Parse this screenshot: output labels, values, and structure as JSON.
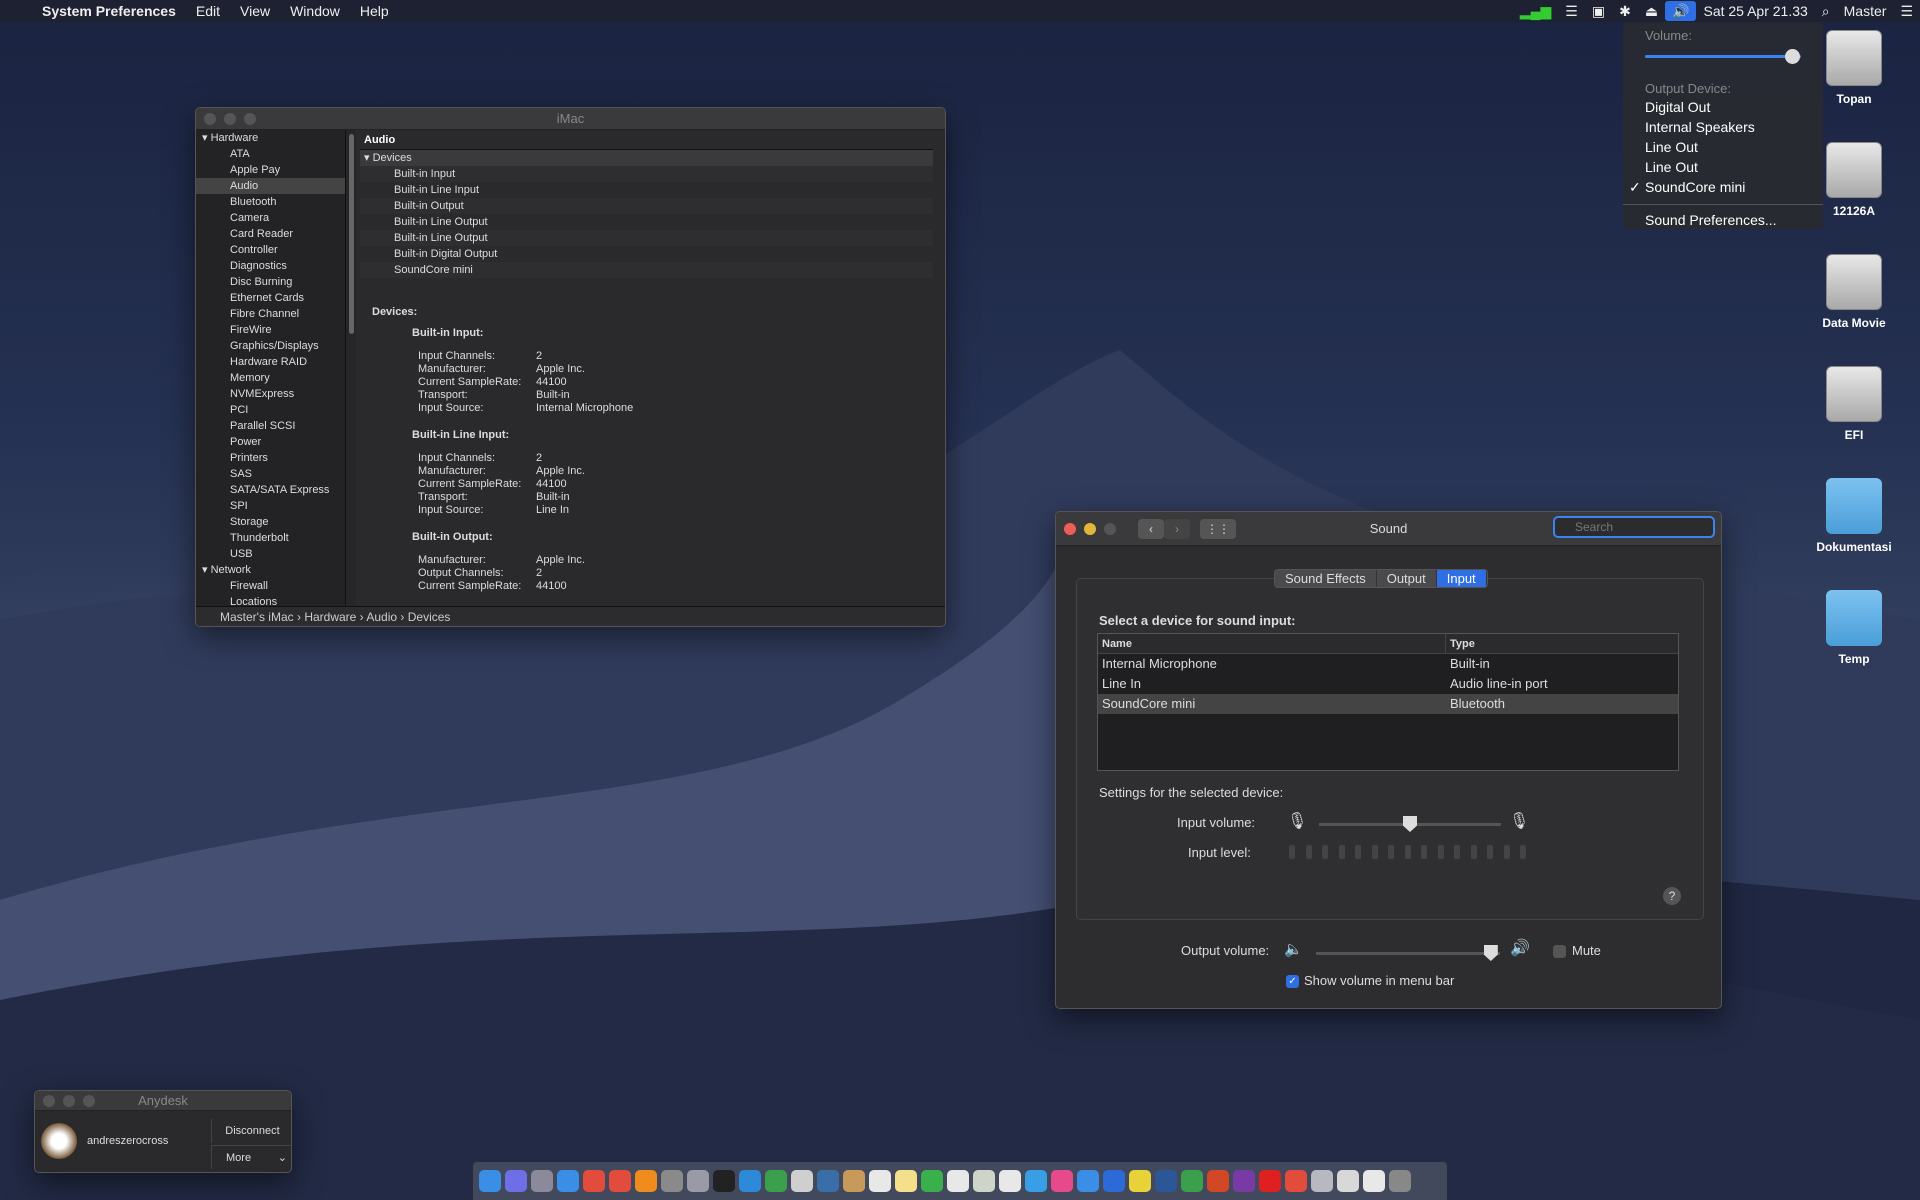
{
  "menubar": {
    "apple": "",
    "app": "System Preferences",
    "items": [
      "Edit",
      "View",
      "Window",
      "Help"
    ],
    "clock": "Sat 25 Apr  21.33",
    "user": "Master"
  },
  "volume_menu": {
    "volume_label": "Volume:",
    "volume_level": 0.95,
    "output_label": "Output Device:",
    "devices": [
      "Digital Out",
      "Internal Speakers",
      "Line Out",
      "Line Out",
      "SoundCore mini"
    ],
    "selected_index": 4,
    "prefs": "Sound Preferences..."
  },
  "imac_window": {
    "title": "iMac",
    "sidebar": [
      {
        "label": "Hardware",
        "group": true
      },
      {
        "label": "ATA"
      },
      {
        "label": "Apple Pay"
      },
      {
        "label": "Audio",
        "selected": true
      },
      {
        "label": "Bluetooth"
      },
      {
        "label": "Camera"
      },
      {
        "label": "Card Reader"
      },
      {
        "label": "Controller"
      },
      {
        "label": "Diagnostics"
      },
      {
        "label": "Disc Burning"
      },
      {
        "label": "Ethernet Cards"
      },
      {
        "label": "Fibre Channel"
      },
      {
        "label": "FireWire"
      },
      {
        "label": "Graphics/Displays"
      },
      {
        "label": "Hardware RAID"
      },
      {
        "label": "Memory"
      },
      {
        "label": "NVMExpress"
      },
      {
        "label": "PCI"
      },
      {
        "label": "Parallel SCSI"
      },
      {
        "label": "Power"
      },
      {
        "label": "Printers"
      },
      {
        "label": "SAS"
      },
      {
        "label": "SATA/SATA Express"
      },
      {
        "label": "SPI"
      },
      {
        "label": "Storage"
      },
      {
        "label": "Thunderbolt"
      },
      {
        "label": "USB"
      },
      {
        "label": "Network",
        "group": true
      },
      {
        "label": "Firewall"
      },
      {
        "label": "Locations"
      }
    ],
    "section": "Audio",
    "group": "Devices",
    "devices": [
      "Built-in Input",
      "Built-in Line Input",
      "Built-in Output",
      "Built-in Line Output",
      "Built-in Line Output",
      "Built-in Digital Output",
      "SoundCore mini"
    ],
    "detail_heading": "Devices:",
    "details": [
      {
        "name": "Built-in Input:",
        "props": [
          [
            "Input Channels:",
            "2"
          ],
          [
            "Manufacturer:",
            "Apple Inc."
          ],
          [
            "Current SampleRate:",
            "44100"
          ],
          [
            "Transport:",
            "Built-in"
          ],
          [
            "Input Source:",
            "Internal Microphone"
          ]
        ]
      },
      {
        "name": "Built-in Line Input:",
        "props": [
          [
            "Input Channels:",
            "2"
          ],
          [
            "Manufacturer:",
            "Apple Inc."
          ],
          [
            "Current SampleRate:",
            "44100"
          ],
          [
            "Transport:",
            "Built-in"
          ],
          [
            "Input Source:",
            "Line In"
          ]
        ]
      },
      {
        "name": "Built-in Output:",
        "props": [
          [
            "Manufacturer:",
            "Apple Inc."
          ],
          [
            "Output Channels:",
            "2"
          ],
          [
            "Current SampleRate:",
            "44100"
          ]
        ]
      }
    ],
    "path": [
      "Master's iMac",
      "Hardware",
      "Audio",
      "Devices"
    ]
  },
  "sound_window": {
    "title": "Sound",
    "search_placeholder": "Search",
    "tabs": [
      "Sound Effects",
      "Output",
      "Input"
    ],
    "active_tab": 2,
    "select_label": "Select a device for sound input:",
    "col_name": "Name",
    "col_type": "Type",
    "rows": [
      {
        "name": "Internal Microphone",
        "type": "Built-in"
      },
      {
        "name": "Line In",
        "type": "Audio line-in port"
      },
      {
        "name": "SoundCore mini",
        "type": "Bluetooth",
        "selected": true
      }
    ],
    "settings_label": "Settings for the selected device:",
    "input_volume_label": "Input volume:",
    "input_volume": 0.5,
    "input_level_label": "Input level:",
    "output_volume_label": "Output volume:",
    "output_volume": 0.95,
    "mute_label": "Mute",
    "mute": false,
    "show_volume_label": "Show volume in menu bar",
    "show_volume": true,
    "help": "?"
  },
  "desktop_icons": [
    {
      "label": "Topan",
      "kind": "hdd"
    },
    {
      "label": "12126A",
      "kind": "hdd"
    },
    {
      "label": "Data Movie",
      "kind": "hdd"
    },
    {
      "label": "EFI",
      "kind": "hdd"
    },
    {
      "label": "Dokumentasi",
      "kind": "folder"
    },
    {
      "label": "Temp",
      "kind": "folder"
    }
  ],
  "anydesk": {
    "title": "Anydesk",
    "user": "andreszerocross",
    "disconnect": "Disconnect",
    "more": "More"
  },
  "dock_colors": [
    "#3a8ee6",
    "#6e6ee6",
    "#8a8a9a",
    "#3a8ee6",
    "#e24c3c",
    "#e24c3c",
    "#f08c1e",
    "#8a8a8a",
    "#9a9aa6",
    "#222",
    "#2c8ad8",
    "#3aa04c",
    "#cfcfcf",
    "#3a6ea8",
    "#c89a5a",
    "#e8e8e8",
    "#f4e08a",
    "#3ab04c",
    "#e8e8e8",
    "#cfd4c8",
    "#e8e8e8",
    "#3a9ee6",
    "#e64a8a",
    "#3a8ee6",
    "#2c6ad8",
    "#e8d23a",
    "#2b5797",
    "#3aa04c",
    "#d24726",
    "#7a3aa6",
    "#e02020",
    "#e24c3c",
    "#b8b8c0",
    "#d8d8d8",
    "#e8e8e8",
    "#888"
  ]
}
